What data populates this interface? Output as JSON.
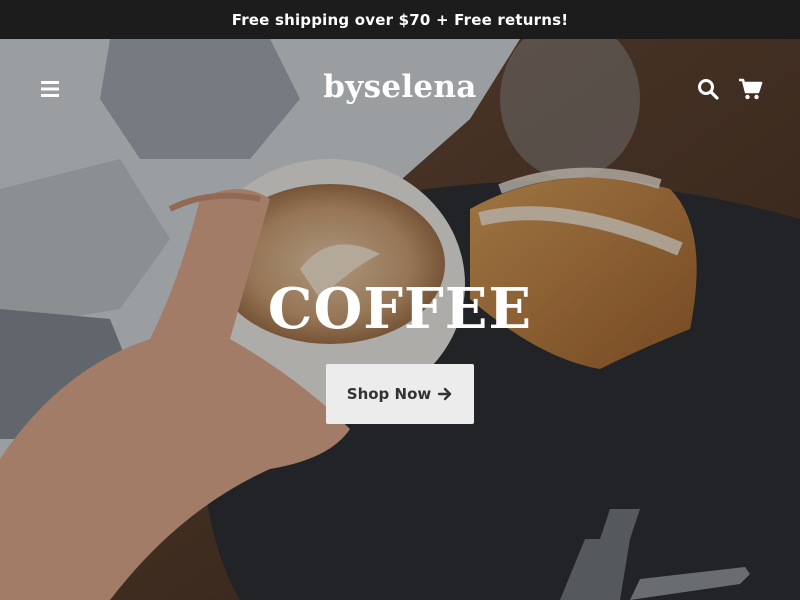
{
  "announcement": {
    "text": "Free shipping over $70 + Free returns!"
  },
  "header": {
    "logo": "byselena",
    "icons": {
      "menu": "hamburger-menu-icon",
      "search": "search-icon",
      "cart": "cart-icon"
    }
  },
  "hero": {
    "title": "COFFEE",
    "button_label": "Shop Now",
    "button_icon": "arrow-right-icon"
  },
  "colors": {
    "announcement_bg": "#1c1c1c",
    "text_light": "#ffffff",
    "button_bg": "#ececec",
    "button_text": "#333333"
  }
}
